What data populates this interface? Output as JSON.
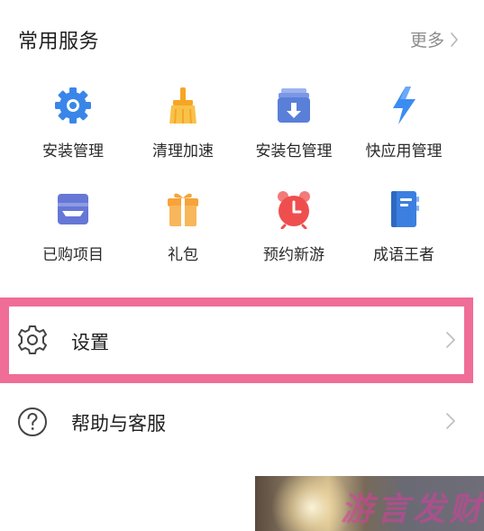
{
  "section": {
    "title": "常用服务",
    "more_label": "更多"
  },
  "services": [
    {
      "label": "安装管理",
      "icon": "gear-icon"
    },
    {
      "label": "清理加速",
      "icon": "broom-icon"
    },
    {
      "label": "安装包管理",
      "icon": "package-download-icon"
    },
    {
      "label": "快应用管理",
      "icon": "lightning-icon"
    },
    {
      "label": "已购项目",
      "icon": "wallet-icon"
    },
    {
      "label": "礼包",
      "icon": "gift-icon"
    },
    {
      "label": "预约新游",
      "icon": "alarm-clock-icon"
    },
    {
      "label": "成语王者",
      "icon": "book-icon"
    }
  ],
  "menu": {
    "settings_label": "设置",
    "help_label": "帮助与客服"
  },
  "watermark": {
    "text": "游言发财"
  },
  "colors": {
    "highlight_border": "#ef6d97",
    "gear_blue": "#3a86e8",
    "broom_orange": "#f6a623",
    "package_blue": "#5a7fd9",
    "lightning_blue": "#3b8cf2",
    "wallet_purple": "#6677d6",
    "gift_orange": "#f7a33a",
    "clock_red": "#ef4e4e",
    "book_blue": "#3b7fe0"
  }
}
